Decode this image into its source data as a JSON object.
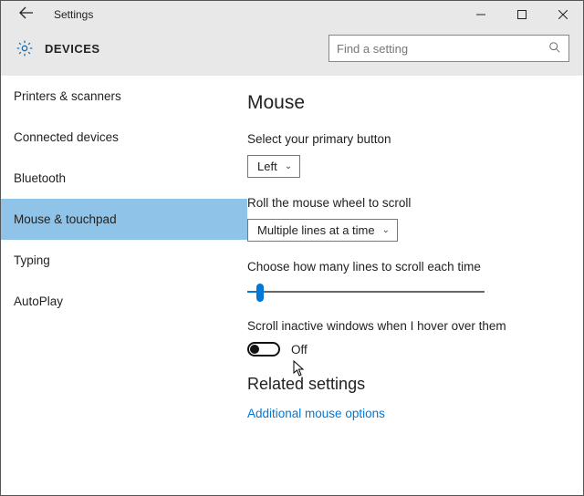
{
  "window": {
    "title": "Settings"
  },
  "header": {
    "title": "DEVICES"
  },
  "search": {
    "placeholder": "Find a setting"
  },
  "sidebar": {
    "items": [
      {
        "label": "Printers & scanners"
      },
      {
        "label": "Connected devices"
      },
      {
        "label": "Bluetooth"
      },
      {
        "label": "Mouse & touchpad"
      },
      {
        "label": "Typing"
      },
      {
        "label": "AutoPlay"
      }
    ],
    "selected_index": 3
  },
  "main": {
    "heading": "Mouse",
    "primary_button": {
      "label": "Select your primary button",
      "value": "Left"
    },
    "wheel_scroll": {
      "label": "Roll the mouse wheel to scroll",
      "value": "Multiple lines at a time"
    },
    "lines_each_time": {
      "label": "Choose how many lines to scroll each time"
    },
    "inactive_windows": {
      "label": "Scroll inactive windows when I hover over them",
      "state": "Off"
    },
    "related_heading": "Related settings",
    "link": "Additional mouse options"
  }
}
